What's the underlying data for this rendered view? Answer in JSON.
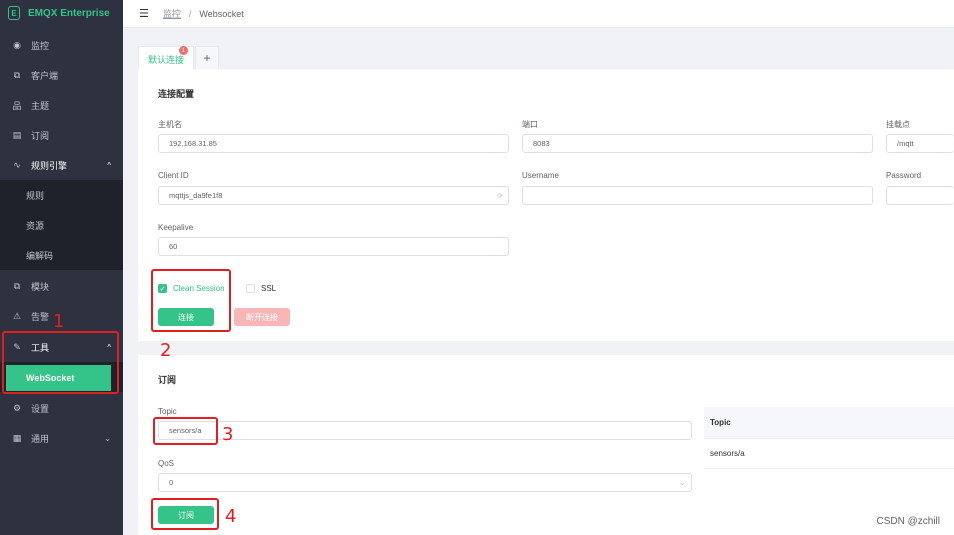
{
  "brand": {
    "logo_glyph": "E",
    "name": "EMQX Enterprise"
  },
  "sidebar": {
    "items": [
      {
        "label": "监控",
        "icon": "monitor-icon",
        "glyph": "◉"
      },
      {
        "label": "客户端",
        "icon": "clients-icon",
        "glyph": "⧉"
      },
      {
        "label": "主题",
        "icon": "topics-icon",
        "glyph": "品"
      },
      {
        "label": "订阅",
        "icon": "subscriptions-icon",
        "glyph": "▤"
      },
      {
        "label": "规则引擎",
        "icon": "rule-engine-icon",
        "glyph": "∿",
        "chevron": "^"
      },
      {
        "label": "规则"
      },
      {
        "label": "资源"
      },
      {
        "label": "编解码"
      },
      {
        "label": "模块",
        "icon": "modules-icon",
        "glyph": "⧉"
      },
      {
        "label": "告警",
        "icon": "alarm-icon",
        "glyph": "⚠"
      },
      {
        "label": "工具",
        "icon": "tools-icon",
        "glyph": "✎",
        "chevron": "^"
      },
      {
        "label": "WebSocket"
      },
      {
        "label": "设置",
        "icon": "settings-icon",
        "glyph": "⚙"
      },
      {
        "label": "通用",
        "icon": "general-icon",
        "glyph": "▦",
        "chevron": "⌄"
      }
    ]
  },
  "topbar": {
    "menu_glyph": "☰",
    "breadcrumb_parent": "监控",
    "breadcrumb_sep": "/",
    "breadcrumb_current": "Websocket"
  },
  "tabs": {
    "active_label": "默认连接",
    "badge": "1",
    "add_glyph": "+"
  },
  "connection": {
    "title": "连接配置",
    "host_label": "主机名",
    "host_value": "192.168.31.85",
    "port_label": "端口",
    "port_value": "8083",
    "path_label": "挂载点",
    "path_value": "/mqtt",
    "clientid_label": "Client ID",
    "clientid_value": "mqttjs_da9fe1f8",
    "clientid_suffix": "⟳",
    "username_label": "Username",
    "username_value": "",
    "password_label": "Password",
    "password_value": "",
    "keepalive_label": "Keepalive",
    "keepalive_value": "60",
    "clean_session_label": "Clean Session",
    "clean_session_checked": true,
    "check_glyph": "✓",
    "ssl_label": "SSL",
    "ssl_checked": false,
    "connect_button": "连接",
    "disconnect_button": "断开连接"
  },
  "subscribe": {
    "title": "订阅",
    "topic_label": "Topic",
    "topic_value": "sensors/a",
    "qos_label": "QoS",
    "qos_value": "0",
    "qos_chevron": "⌄",
    "subscribe_button": "订阅",
    "table_header": "Topic",
    "table_rows": [
      "sensors/a"
    ]
  },
  "annotations": [
    "1",
    "2",
    "3",
    "4"
  ],
  "watermark": "CSDN @zchill",
  "colors": {
    "accent": "#34c388",
    "sidebar": "#2e3240",
    "annotation": "#e02020",
    "danger_light": "#fab6b6"
  }
}
